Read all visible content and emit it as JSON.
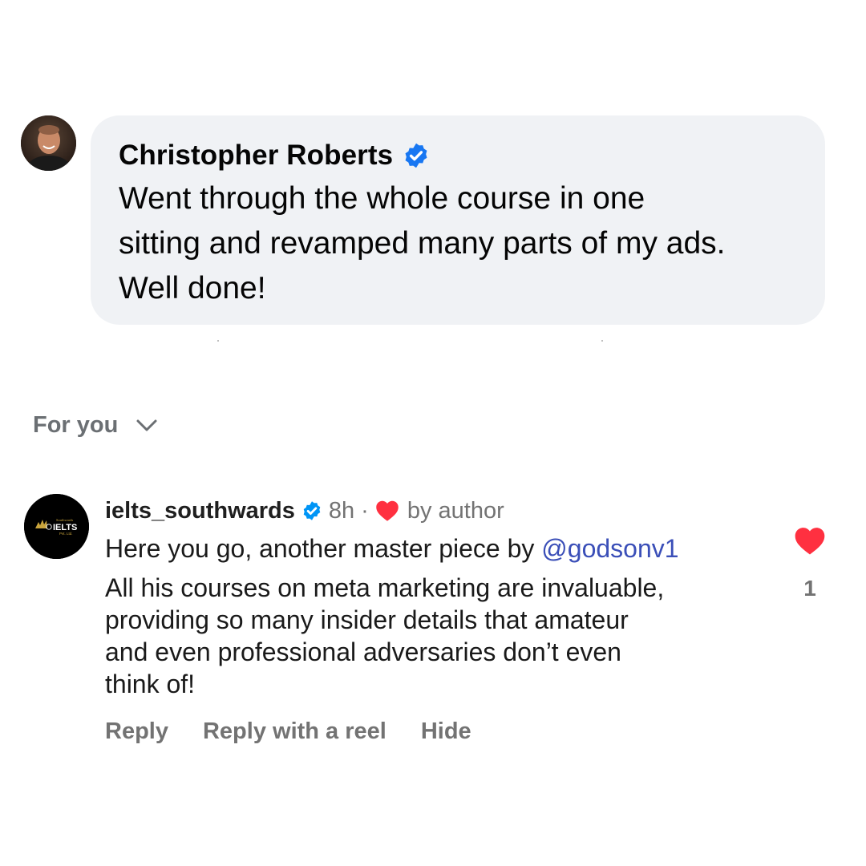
{
  "top_comment": {
    "author": "Christopher Roberts",
    "verified": true,
    "lines": [
      "Went through the whole course in one",
      "sitting and revamped many parts of my ads.",
      "Well done!"
    ]
  },
  "sort": {
    "label": "For you",
    "icon": "chevron-down-icon"
  },
  "comment": {
    "avatar_logo": {
      "small": "Southwards",
      "main": "IELTS",
      "sub": "Pvt. Ltd."
    },
    "username": "ielts_southwards",
    "verified": true,
    "time": "8h",
    "separator": "·",
    "liked_by_author_label": "by author",
    "body": {
      "first_line_text": "Here you go, another master piece by ",
      "mention": "@godsonv1",
      "lines": [
        "All his courses on meta marketing are invaluable,",
        "providing so many insider details that amateur",
        "and even professional adversaries don’t even",
        "think of!"
      ]
    },
    "like": {
      "icon": "heart-icon",
      "count": "1",
      "liked": true
    },
    "actions": [
      "Reply",
      "Reply with a reel",
      "Hide"
    ]
  },
  "colors": {
    "bubble_bg": "#f0f2f5",
    "verified_blue": "#1877f2",
    "ig_verified_blue": "#0095f6",
    "heart_red": "#ff3040",
    "mention_blue": "#3b4fb8",
    "muted_text": "#737373"
  }
}
